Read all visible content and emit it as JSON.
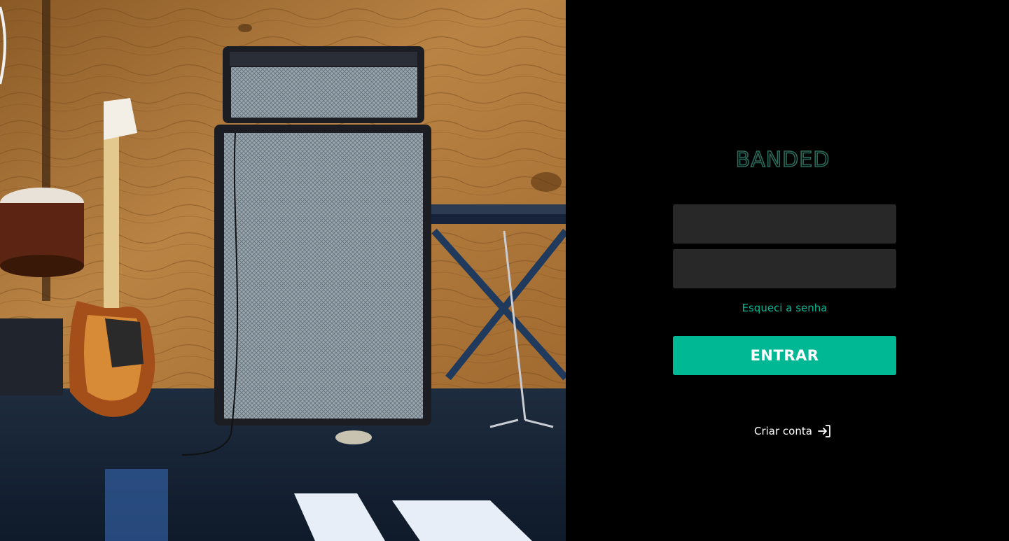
{
  "brand": {
    "logo_text": "BANDED",
    "logo_color": "#2a6a5a"
  },
  "login": {
    "username_placeholder": "",
    "password_placeholder": "",
    "forgot_label": "Esqueci a senha",
    "submit_label": "ENTRAR",
    "create_account_label": "Criar conta"
  },
  "colors": {
    "accent": "#00b894",
    "field_bg": "#282828",
    "panel_bg": "#000000"
  },
  "icons": {
    "create_account_icon": "sign-in-arrow-icon"
  }
}
